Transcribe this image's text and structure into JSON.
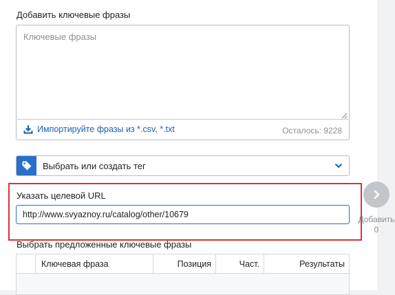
{
  "keywords": {
    "label": "Добавить ключевые фразы",
    "placeholder": "Ключевые фразы",
    "import_link": "Импортируйте фразы из *.csv, *.txt",
    "remaining": "Осталось: 9228"
  },
  "tag_select": {
    "selected": "Выбрать или создать тег",
    "icon": "tag-icon"
  },
  "target_url": {
    "label": "Указать целевой URL",
    "value": "http://www.svyaznoy.ru/catalog/other/10679"
  },
  "add_action": {
    "label_line1": "Добавить",
    "count": "0",
    "icon": "chevron-right-icon"
  },
  "suggested": {
    "label": "Выбрать предложенные ключевые фразы",
    "columns": [
      "Ключевая фраза",
      "Позиция",
      "Част.",
      "Результаты"
    ]
  },
  "colors": {
    "accent": "#2a6fc9",
    "highlight": "#d6323a",
    "link": "#1c5fb3"
  }
}
